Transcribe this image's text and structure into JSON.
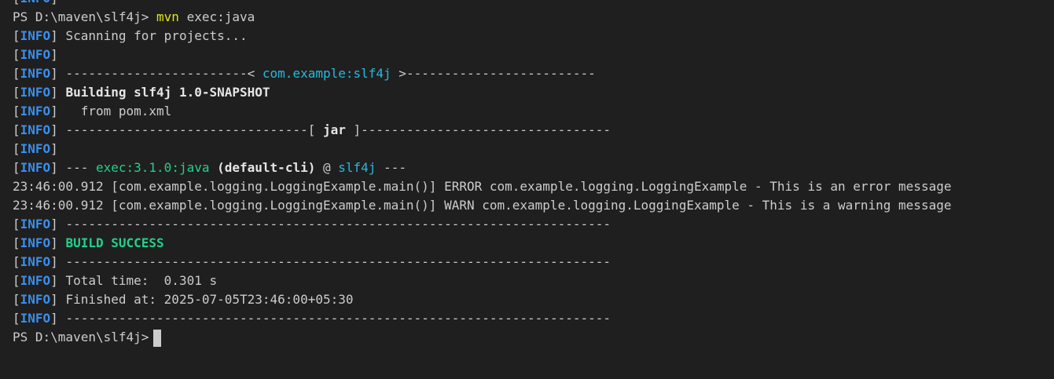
{
  "tag": {
    "info": "INFO",
    "open": "[",
    "close": "]"
  },
  "lines": {
    "l0_rest": " ------------------------------------------------------------------------",
    "prompt1": "PS D:\\maven\\slf4j> ",
    "cmd": "mvn",
    "cmd_args": " exec:java",
    "l2_rest": " Scanning for projects...",
    "l4_pre": " ------------------------< ",
    "l4_artifact": "com.example:slf4j",
    "l4_post": " >-------------------------",
    "l5_rest": " Building slf4j 1.0-SNAPSHOT",
    "l6_rest": "   from pom.xml",
    "l7_pre": " --------------------------------[ ",
    "l7_mid": "jar",
    "l7_post": " ]---------------------------------",
    "l9_pre": " --- ",
    "l9_plugin": "exec:3.1.0:java",
    "l9_exec": " (default-cli)",
    "l9_at": " @ ",
    "l9_proj": "slf4j",
    "l9_post": " ---",
    "log_error": "23:46:00.912 [com.example.logging.LoggingExample.main()] ERROR com.example.logging.LoggingExample - This is an error message",
    "log_warn": "23:46:00.912 [com.example.logging.LoggingExample.main()] WARN com.example.logging.LoggingExample - This is a warning message",
    "sep": " ------------------------------------------------------------------------",
    "build_success": " BUILD SUCCESS",
    "total_time": " Total time:  0.301 s",
    "finished_at": " Finished at: 2025-07-05T23:46:00+05:30",
    "prompt2": "PS D:\\maven\\slf4j>"
  }
}
